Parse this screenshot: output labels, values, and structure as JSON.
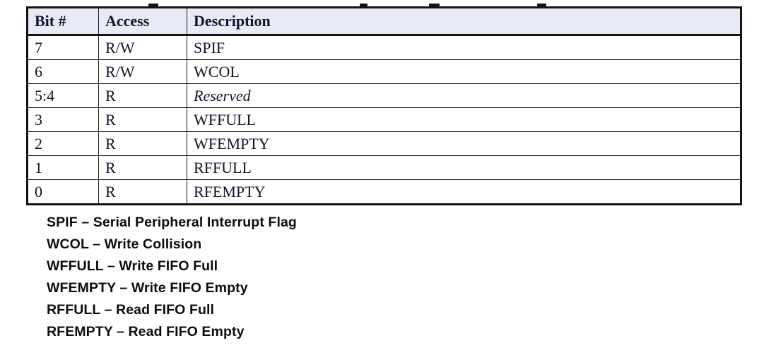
{
  "colors": {
    "header_background": "#e9eaf8",
    "table_border": "#141414",
    "table_text": "#14142d",
    "legend_text": "#0d0d0d",
    "page_background": "#ffffff"
  },
  "register_table": {
    "columns": [
      "Bit #",
      "Access",
      "Description"
    ],
    "rows": [
      {
        "bit": "7",
        "access": "R/W",
        "description": "SPIF",
        "description_style": "normal"
      },
      {
        "bit": "6",
        "access": "R/W",
        "description": "WCOL",
        "description_style": "normal"
      },
      {
        "bit": "5:4",
        "access": "R",
        "description": "Reserved",
        "description_style": "italic"
      },
      {
        "bit": "3",
        "access": "R",
        "description": "WFFULL",
        "description_style": "normal"
      },
      {
        "bit": "2",
        "access": "R",
        "description": "WFEMPTY",
        "description_style": "normal"
      },
      {
        "bit": "1",
        "access": "R",
        "description": "RFFULL",
        "description_style": "normal"
      },
      {
        "bit": "0",
        "access": "R",
        "description": "RFEMPTY",
        "description_style": "normal"
      }
    ]
  },
  "legend": {
    "lines": [
      {
        "abbr": "SPIF",
        "separator": "–",
        "meaning": "Serial Peripheral Interrupt Flag",
        "text": "SPIF – Serial Peripheral Interrupt Flag"
      },
      {
        "abbr": "WCOL",
        "separator": "–",
        "meaning": "Write Collision",
        "text": "WCOL – Write Collision"
      },
      {
        "abbr": "WFFULL",
        "separator": "–",
        "meaning": "Write FIFO Full",
        "text": "WFFULL – Write FIFO Full"
      },
      {
        "abbr": "WFEMPTY",
        "separator": "–",
        "meaning": "Write FIFO Empty",
        "text": "WFEMPTY – Write FIFO Empty"
      },
      {
        "abbr": "RFFULL",
        "separator": "–",
        "meaning": "Read FIFO Full",
        "text": "RFFULL – Read FIFO Full"
      },
      {
        "abbr": "RFEMPTY",
        "separator": "–",
        "meaning": "Read FIFO Empty",
        "text": "RFEMPTY – Read FIFO Empty"
      }
    ]
  }
}
